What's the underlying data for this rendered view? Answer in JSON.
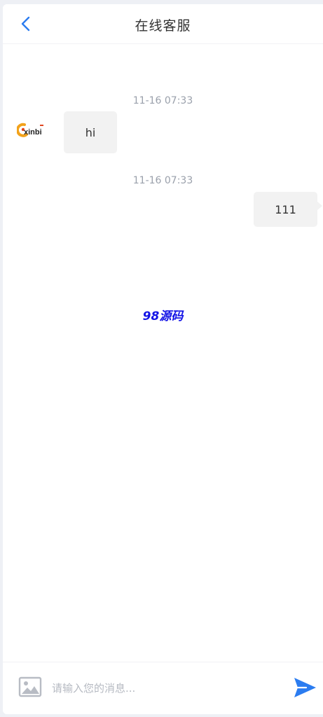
{
  "header": {
    "title": "在线客服",
    "back_icon": "chevron-left-icon"
  },
  "colors": {
    "accent": "#2b7cf0",
    "bubble": "#f2f2f2",
    "timestamp": "#9aa0ab",
    "watermark": "#1414e6"
  },
  "messages": [
    {
      "time": "11-16 07:33",
      "direction": "incoming",
      "text": "hi",
      "avatar_logo": "xinbi"
    },
    {
      "time": "11-16 07:33",
      "direction": "outgoing",
      "text": "111"
    }
  ],
  "watermark": "98源码",
  "composer": {
    "placeholder": "请输入您的消息...",
    "value": "",
    "image_icon": "image-icon",
    "send_icon": "send-icon"
  }
}
